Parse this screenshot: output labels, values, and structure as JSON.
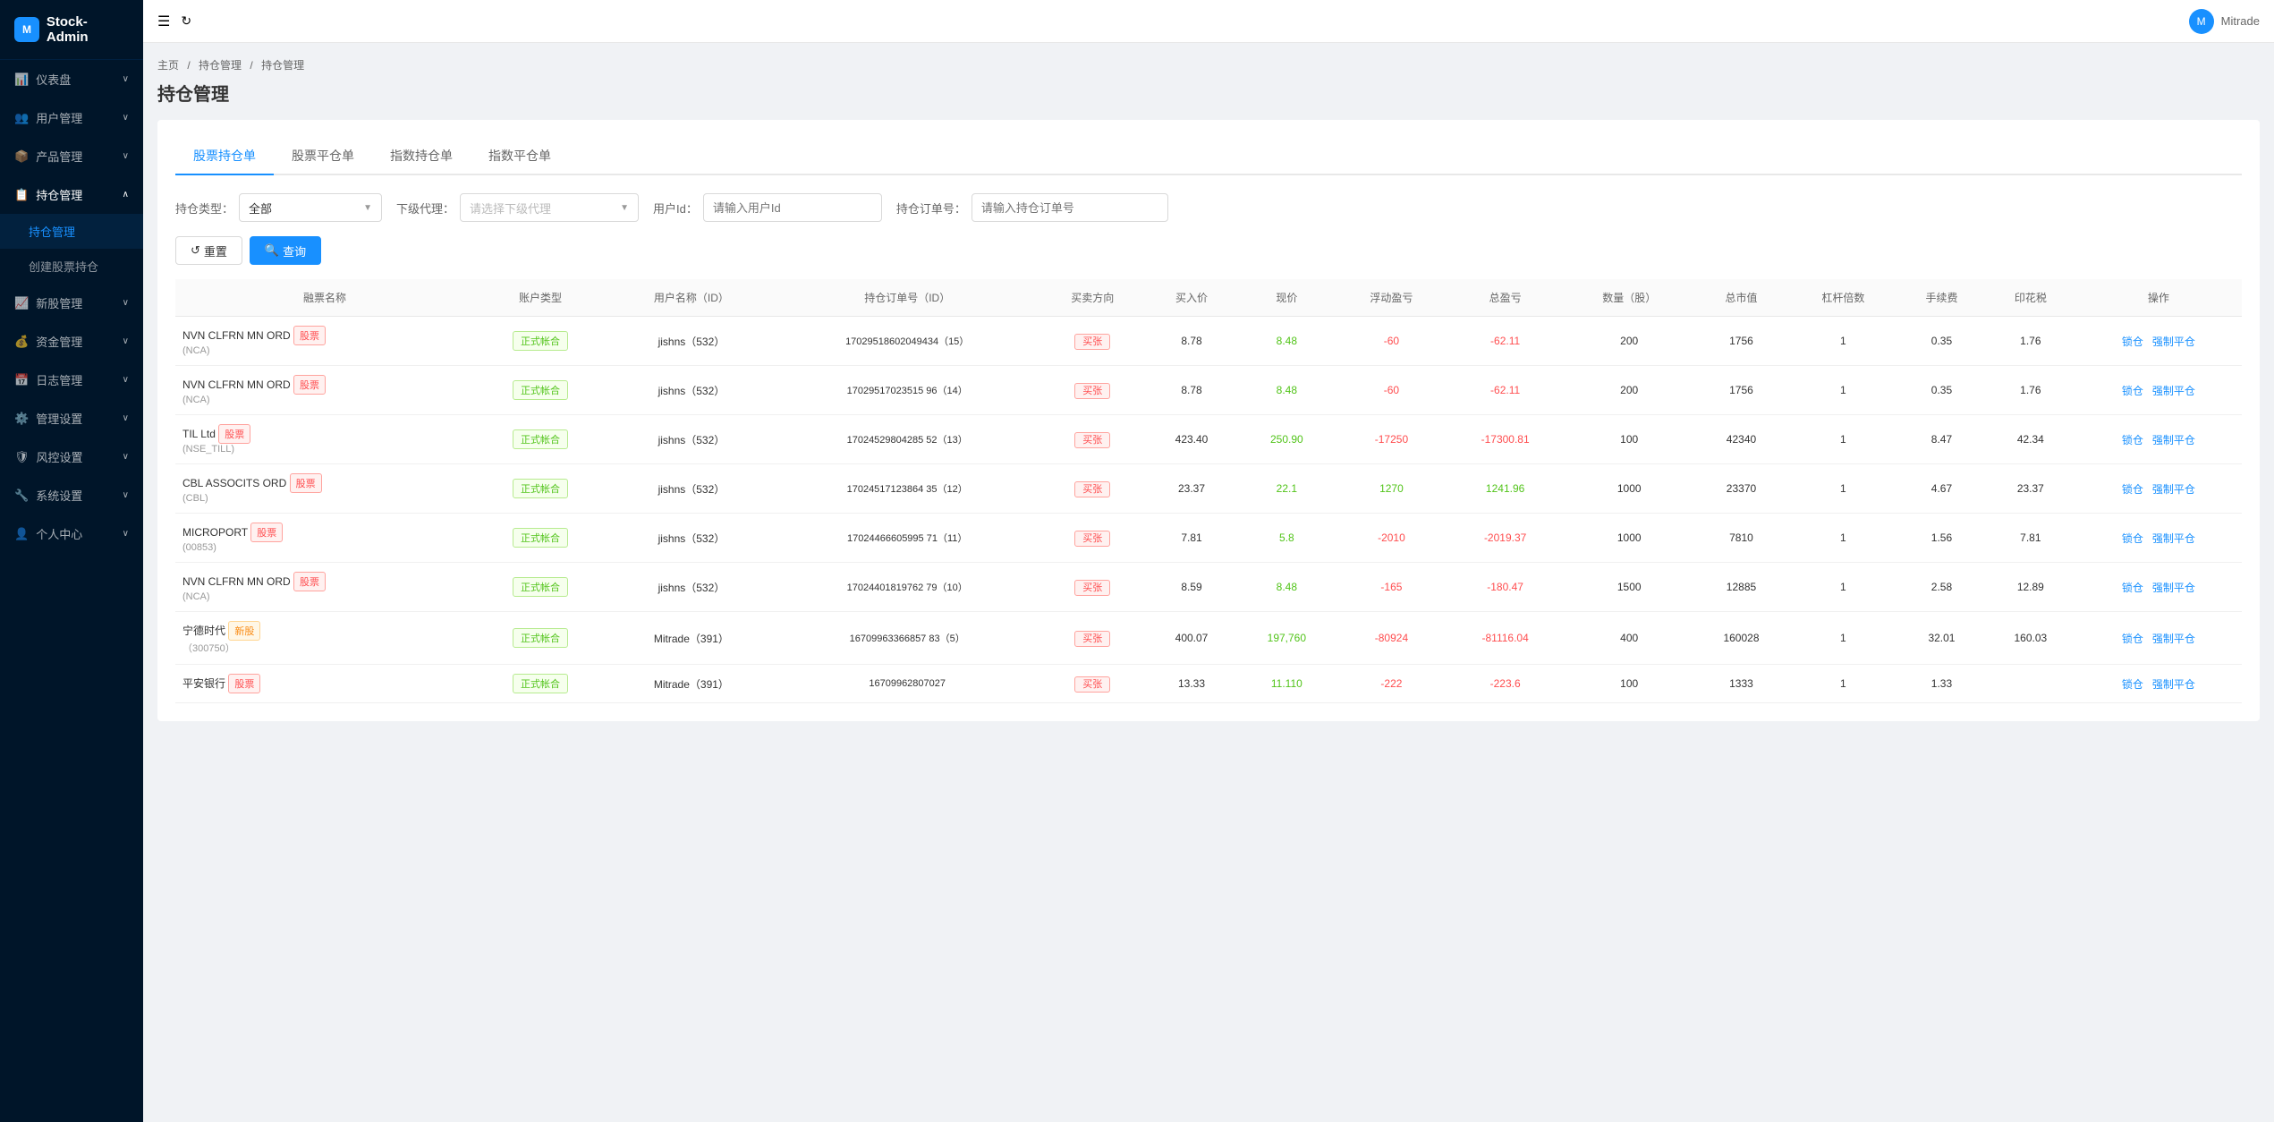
{
  "app": {
    "name": "Stock-Admin",
    "logo_text": "M"
  },
  "user": {
    "name": "Mitrade",
    "avatar": "M"
  },
  "sidebar": {
    "items": [
      {
        "id": "dashboard",
        "label": "仪表盘",
        "icon": "📊",
        "hasArrow": true
      },
      {
        "id": "user-mgmt",
        "label": "用户管理",
        "icon": "👥",
        "hasArrow": true
      },
      {
        "id": "product-mgmt",
        "label": "产品管理",
        "icon": "📦",
        "hasArrow": true
      },
      {
        "id": "position-mgmt",
        "label": "持仓管理",
        "icon": "📋",
        "hasArrow": true,
        "open": true
      },
      {
        "id": "new-stock",
        "label": "新股管理",
        "icon": "📈",
        "hasArrow": true
      },
      {
        "id": "capital-mgmt",
        "label": "资金管理",
        "icon": "💰",
        "hasArrow": true
      },
      {
        "id": "daily-mgmt",
        "label": "日志管理",
        "icon": "📅",
        "hasArrow": true
      },
      {
        "id": "system-settings",
        "label": "管理设置",
        "icon": "⚙️",
        "hasArrow": true
      },
      {
        "id": "risk-settings",
        "label": "风控设置",
        "icon": "🛡",
        "hasArrow": true
      },
      {
        "id": "sys-settings2",
        "label": "系统设置",
        "icon": "🔧",
        "hasArrow": true
      },
      {
        "id": "personal",
        "label": "个人中心",
        "icon": "👤",
        "hasArrow": true
      }
    ],
    "sub_items": [
      {
        "id": "position-list",
        "label": "持仓管理",
        "active": true
      },
      {
        "id": "create-position",
        "label": "创建股票持仓"
      }
    ]
  },
  "breadcrumb": {
    "items": [
      "主页",
      "持仓管理",
      "持仓管理"
    ]
  },
  "page": {
    "title": "持仓管理"
  },
  "tabs": [
    {
      "id": "stock-hold",
      "label": "股票持仓单",
      "active": true
    },
    {
      "id": "stock-close",
      "label": "股票平仓单"
    },
    {
      "id": "index-hold",
      "label": "指数持仓单"
    },
    {
      "id": "index-close",
      "label": "指数平仓单"
    }
  ],
  "filters": {
    "hold_type_label": "持仓类型：",
    "hold_type_value": "全部",
    "sub_agent_label": "下级代理：",
    "sub_agent_placeholder": "请选择下级代理",
    "user_id_label": "用户Id：",
    "user_id_placeholder": "请输入用户Id",
    "order_no_label": "持仓订单号：",
    "order_no_placeholder": "请输入持仓订单号"
  },
  "buttons": {
    "reset": "重置",
    "search": "查询"
  },
  "table": {
    "columns": [
      "融票名称",
      "账户类型",
      "用户名称（ID）",
      "持仓订单号（ID）",
      "买卖方向",
      "买入价",
      "现价",
      "浮动盈亏",
      "总盈亏",
      "数量（股）",
      "总市值",
      "杠杆倍数",
      "手续费",
      "印花税",
      "操作"
    ],
    "rows": [
      {
        "name": "NVN CLFRN MN ORD",
        "name_badge": "股票",
        "name_sub": "(NCA)",
        "account_type": "正式帐合",
        "user": "jishns（532）",
        "order_id": "17029518602049434（15）",
        "direction": "买张",
        "buy_price": "8.78",
        "current_price": "8.48",
        "float_pnl": "-60",
        "total_pnl": "-62.11",
        "qty": "200",
        "total_value": "1756",
        "leverage": "1",
        "commission": "0.35",
        "stamp": "1.76",
        "actions": [
          "锁仓",
          "强制平仓"
        ]
      },
      {
        "name": "NVN CLFRN MN ORD",
        "name_badge": "股票",
        "name_sub": "(NCA)",
        "account_type": "正式帐合",
        "user": "jishns（532）",
        "order_id": "17029517023515 96（14）",
        "direction": "买张",
        "buy_price": "8.78",
        "current_price": "8.48",
        "float_pnl": "-60",
        "total_pnl": "-62.11",
        "qty": "200",
        "total_value": "1756",
        "leverage": "1",
        "commission": "0.35",
        "stamp": "1.76",
        "actions": [
          "锁仓",
          "强制平仓"
        ]
      },
      {
        "name": "TIL Ltd",
        "name_badge": "股票",
        "name_sub": "(NSE_TILL)",
        "account_type": "正式帐合",
        "user": "jishns（532）",
        "order_id": "17024529804285 52（13）",
        "direction": "买张",
        "buy_price": "423.40",
        "current_price": "250.90",
        "float_pnl": "-17250",
        "total_pnl": "-17300.81",
        "qty": "100",
        "total_value": "42340",
        "leverage": "1",
        "commission": "8.47",
        "stamp": "42.34",
        "actions": [
          "锁仓",
          "强制平仓"
        ]
      },
      {
        "name": "CBL ASSOCITS ORD",
        "name_badge": "股票",
        "name_sub": "(CBL)",
        "account_type": "正式帐合",
        "user": "jishns（532）",
        "order_id": "17024517123864 35（12）",
        "direction": "买张",
        "buy_price": "23.37",
        "current_price": "22.1",
        "float_pnl": "1270",
        "total_pnl": "1241.96",
        "qty": "1000",
        "total_value": "23370",
        "leverage": "1",
        "commission": "4.67",
        "stamp": "23.37",
        "actions": [
          "锁仓",
          "强制平仓"
        ]
      },
      {
        "name": "MICROPORT",
        "name_badge": "股票",
        "name_sub": "(00853)",
        "account_type": "正式帐合",
        "user": "jishns（532）",
        "order_id": "17024466605995 71（11）",
        "direction": "买张",
        "buy_price": "7.81",
        "current_price": "5.8",
        "float_pnl": "-2010",
        "total_pnl": "-2019.37",
        "qty": "1000",
        "total_value": "7810",
        "leverage": "1",
        "commission": "1.56",
        "stamp": "7.81",
        "actions": [
          "锁仓",
          "强制平仓"
        ]
      },
      {
        "name": "NVN CLFRN MN ORD",
        "name_badge": "股票",
        "name_sub": "(NCA)",
        "account_type": "正式帐合",
        "user": "jishns（532）",
        "order_id": "17024401819762 79（10）",
        "direction": "买张",
        "buy_price": "8.59",
        "current_price": "8.48",
        "float_pnl": "-165",
        "total_pnl": "-180.47",
        "qty": "1500",
        "total_value": "12885",
        "leverage": "1",
        "commission": "2.58",
        "stamp": "12.89",
        "actions": [
          "锁仓",
          "强制平仓"
        ]
      },
      {
        "name": "宁德时代",
        "name_badge": "新股",
        "name_sub": "（300750）",
        "account_type": "正式帐合",
        "user": "Mitrade（391）",
        "order_id": "16709963366857 83（5）",
        "direction": "买张",
        "buy_price": "400.07",
        "current_price": "197,760",
        "float_pnl": "-80924",
        "total_pnl": "-81116.04",
        "qty": "400",
        "total_value": "160028",
        "leverage": "1",
        "commission": "32.01",
        "stamp": "160.03",
        "actions": [
          "锁仓",
          "强制平仓"
        ]
      },
      {
        "name": "平安银行",
        "name_badge": "股票",
        "name_sub": "",
        "account_type": "正式帐合",
        "user": "Mitrade（391）",
        "order_id": "16709962807027",
        "direction": "买张",
        "buy_price": "13.33",
        "current_price": "11.110",
        "float_pnl": "-222",
        "total_pnl": "-223.6",
        "qty": "100",
        "total_value": "1333",
        "leverage": "1",
        "commission": "1.33",
        "stamp": "",
        "actions": [
          "锁仓",
          "强制平仓"
        ]
      }
    ]
  }
}
